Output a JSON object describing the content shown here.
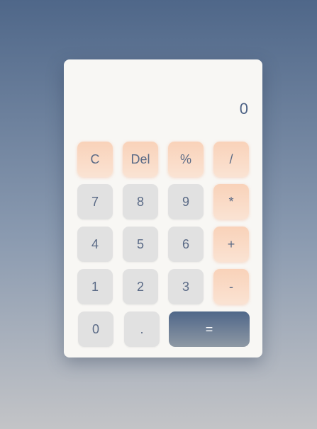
{
  "display": {
    "value": "0"
  },
  "keys": {
    "clear": "C",
    "delete": "Del",
    "percent": "%",
    "divide": "/",
    "seven": "7",
    "eight": "8",
    "nine": "9",
    "multiply": "*",
    "four": "4",
    "five": "5",
    "six": "6",
    "plus": "+",
    "one": "1",
    "two": "2",
    "three": "3",
    "minus": "-",
    "zero": "0",
    "dot": ".",
    "equals": "="
  },
  "colors": {
    "background_top": "#4f6789",
    "background_bottom": "#c3c4c7",
    "panel": "#f8f7f4",
    "number_key": "#e1e1e1",
    "operator_key": "#f9d2b9",
    "equals_key": "#4f6789",
    "text": "#5a6a86"
  }
}
